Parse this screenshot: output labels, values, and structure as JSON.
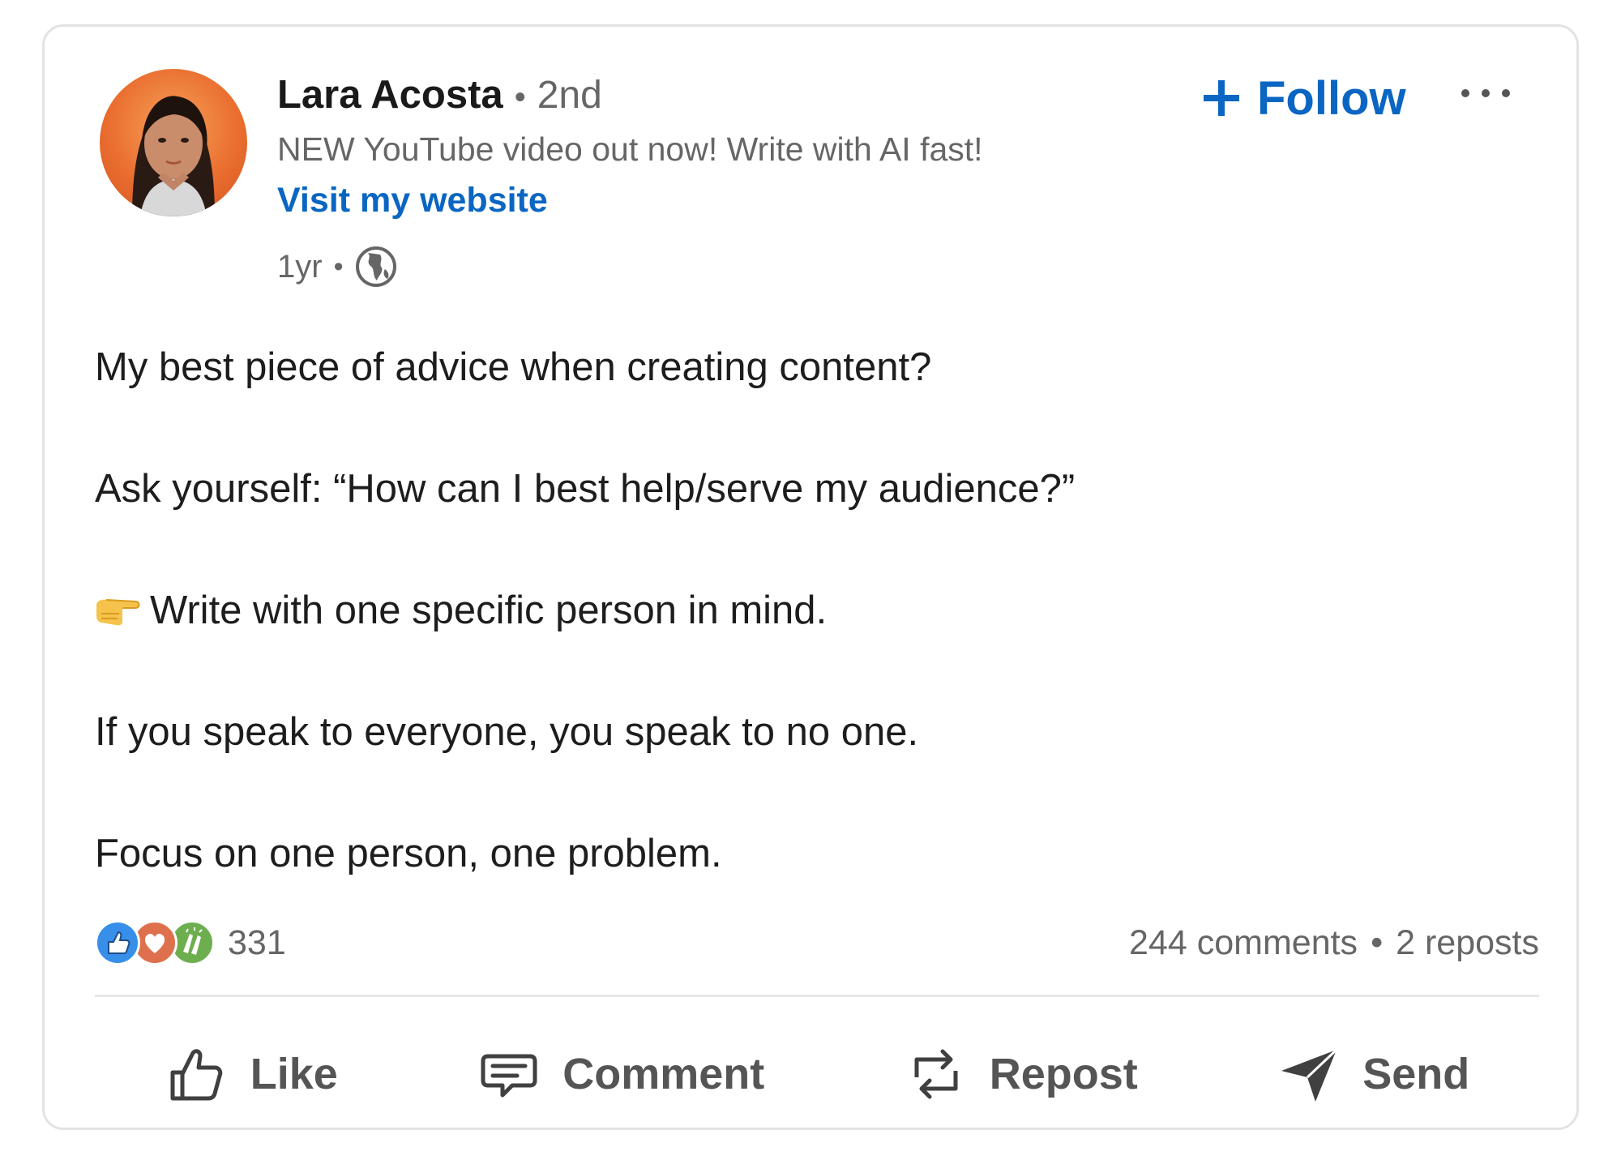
{
  "post": {
    "author": {
      "name": "Lara Acosta",
      "separator": "•",
      "degree": "2nd",
      "headline": "NEW YouTube video out now! Write with AI fast!",
      "website_link": "Visit my website",
      "time": "1yr",
      "meta_separator": "•",
      "visibility_icon": "globe-icon"
    },
    "follow_label": "Follow",
    "follow_icon": "plus-icon",
    "more_icon": "ellipsis-icon",
    "body": {
      "line1": "My best piece of advice when creating content?",
      "line2": "Ask yourself: “How can I best help/serve my audience?”",
      "line3_emoji": "point-right-emoji",
      "line3": "Write with one specific person in mind.",
      "line4": "If you speak to everyone, you speak to no one.",
      "line5": "Focus on one person, one problem."
    },
    "stats": {
      "reaction_icons": [
        "like-reaction-icon",
        "love-reaction-icon",
        "celebrate-reaction-icon"
      ],
      "reaction_count": "331",
      "comments": "244 comments",
      "separator": "•",
      "reposts": "2 reposts"
    },
    "actions": {
      "like": "Like",
      "comment": "Comment",
      "repost": "Repost",
      "send": "Send"
    }
  },
  "colors": {
    "link_blue": "#0a66c2",
    "secondary_text": "#666666",
    "primary_text": "#1d1d1d",
    "avatar_bg": "#ea6f30",
    "like_blue": "#378fe9",
    "love_red": "#df704d",
    "celebrate_green": "#6dae4f"
  }
}
